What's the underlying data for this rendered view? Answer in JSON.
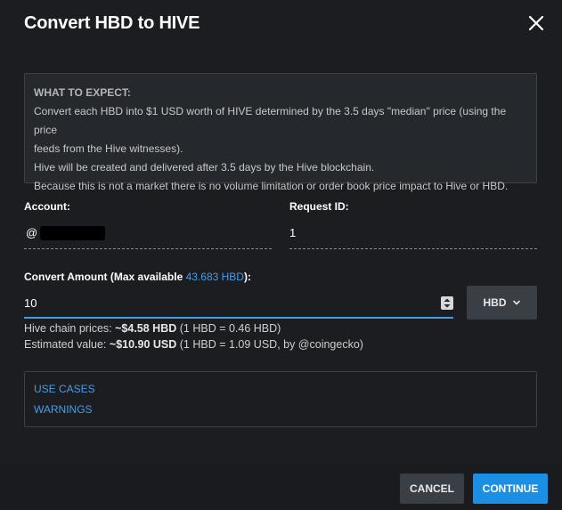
{
  "dialog": {
    "title": "Convert HBD to HIVE"
  },
  "info": {
    "heading": "WHAT TO EXPECT:",
    "line1": "Convert each HBD into $1 USD worth of HIVE determined by the 3.5 days \"median\" price (using the price",
    "line2": "feeds from the Hive witnesses).",
    "line3": "Hive will be created and delivered after 3.5 days by the Hive blockchain.",
    "line4": "Because this is not a market there is no volume limitation or order book price impact to Hive or HBD."
  },
  "account": {
    "label": "Account:",
    "prefix": "@"
  },
  "request": {
    "label": "Request ID:",
    "value": "1"
  },
  "amount": {
    "label_prefix": "Convert Amount (Max available ",
    "max_link": "43.683 HBD",
    "label_suffix": "):",
    "value": "10",
    "currency": "HBD"
  },
  "prices": {
    "chain_label": "Hive chain prices: ",
    "chain_value": "~$4.58 HBD",
    "chain_detail": " (1 HBD = 0.46 HBD)",
    "est_label": "Estimated value: ",
    "est_value": "~$10.90 USD",
    "est_detail": " (1 HBD = 1.09 USD, by @coingecko)"
  },
  "links": {
    "use_cases": "USE CASES",
    "warnings": "WARNINGS"
  },
  "buttons": {
    "cancel": "CANCEL",
    "continue": "CONTINUE"
  },
  "colors": {
    "accent": "#1a8fe3",
    "link": "#4a9be6",
    "background": "#1c1d20"
  }
}
